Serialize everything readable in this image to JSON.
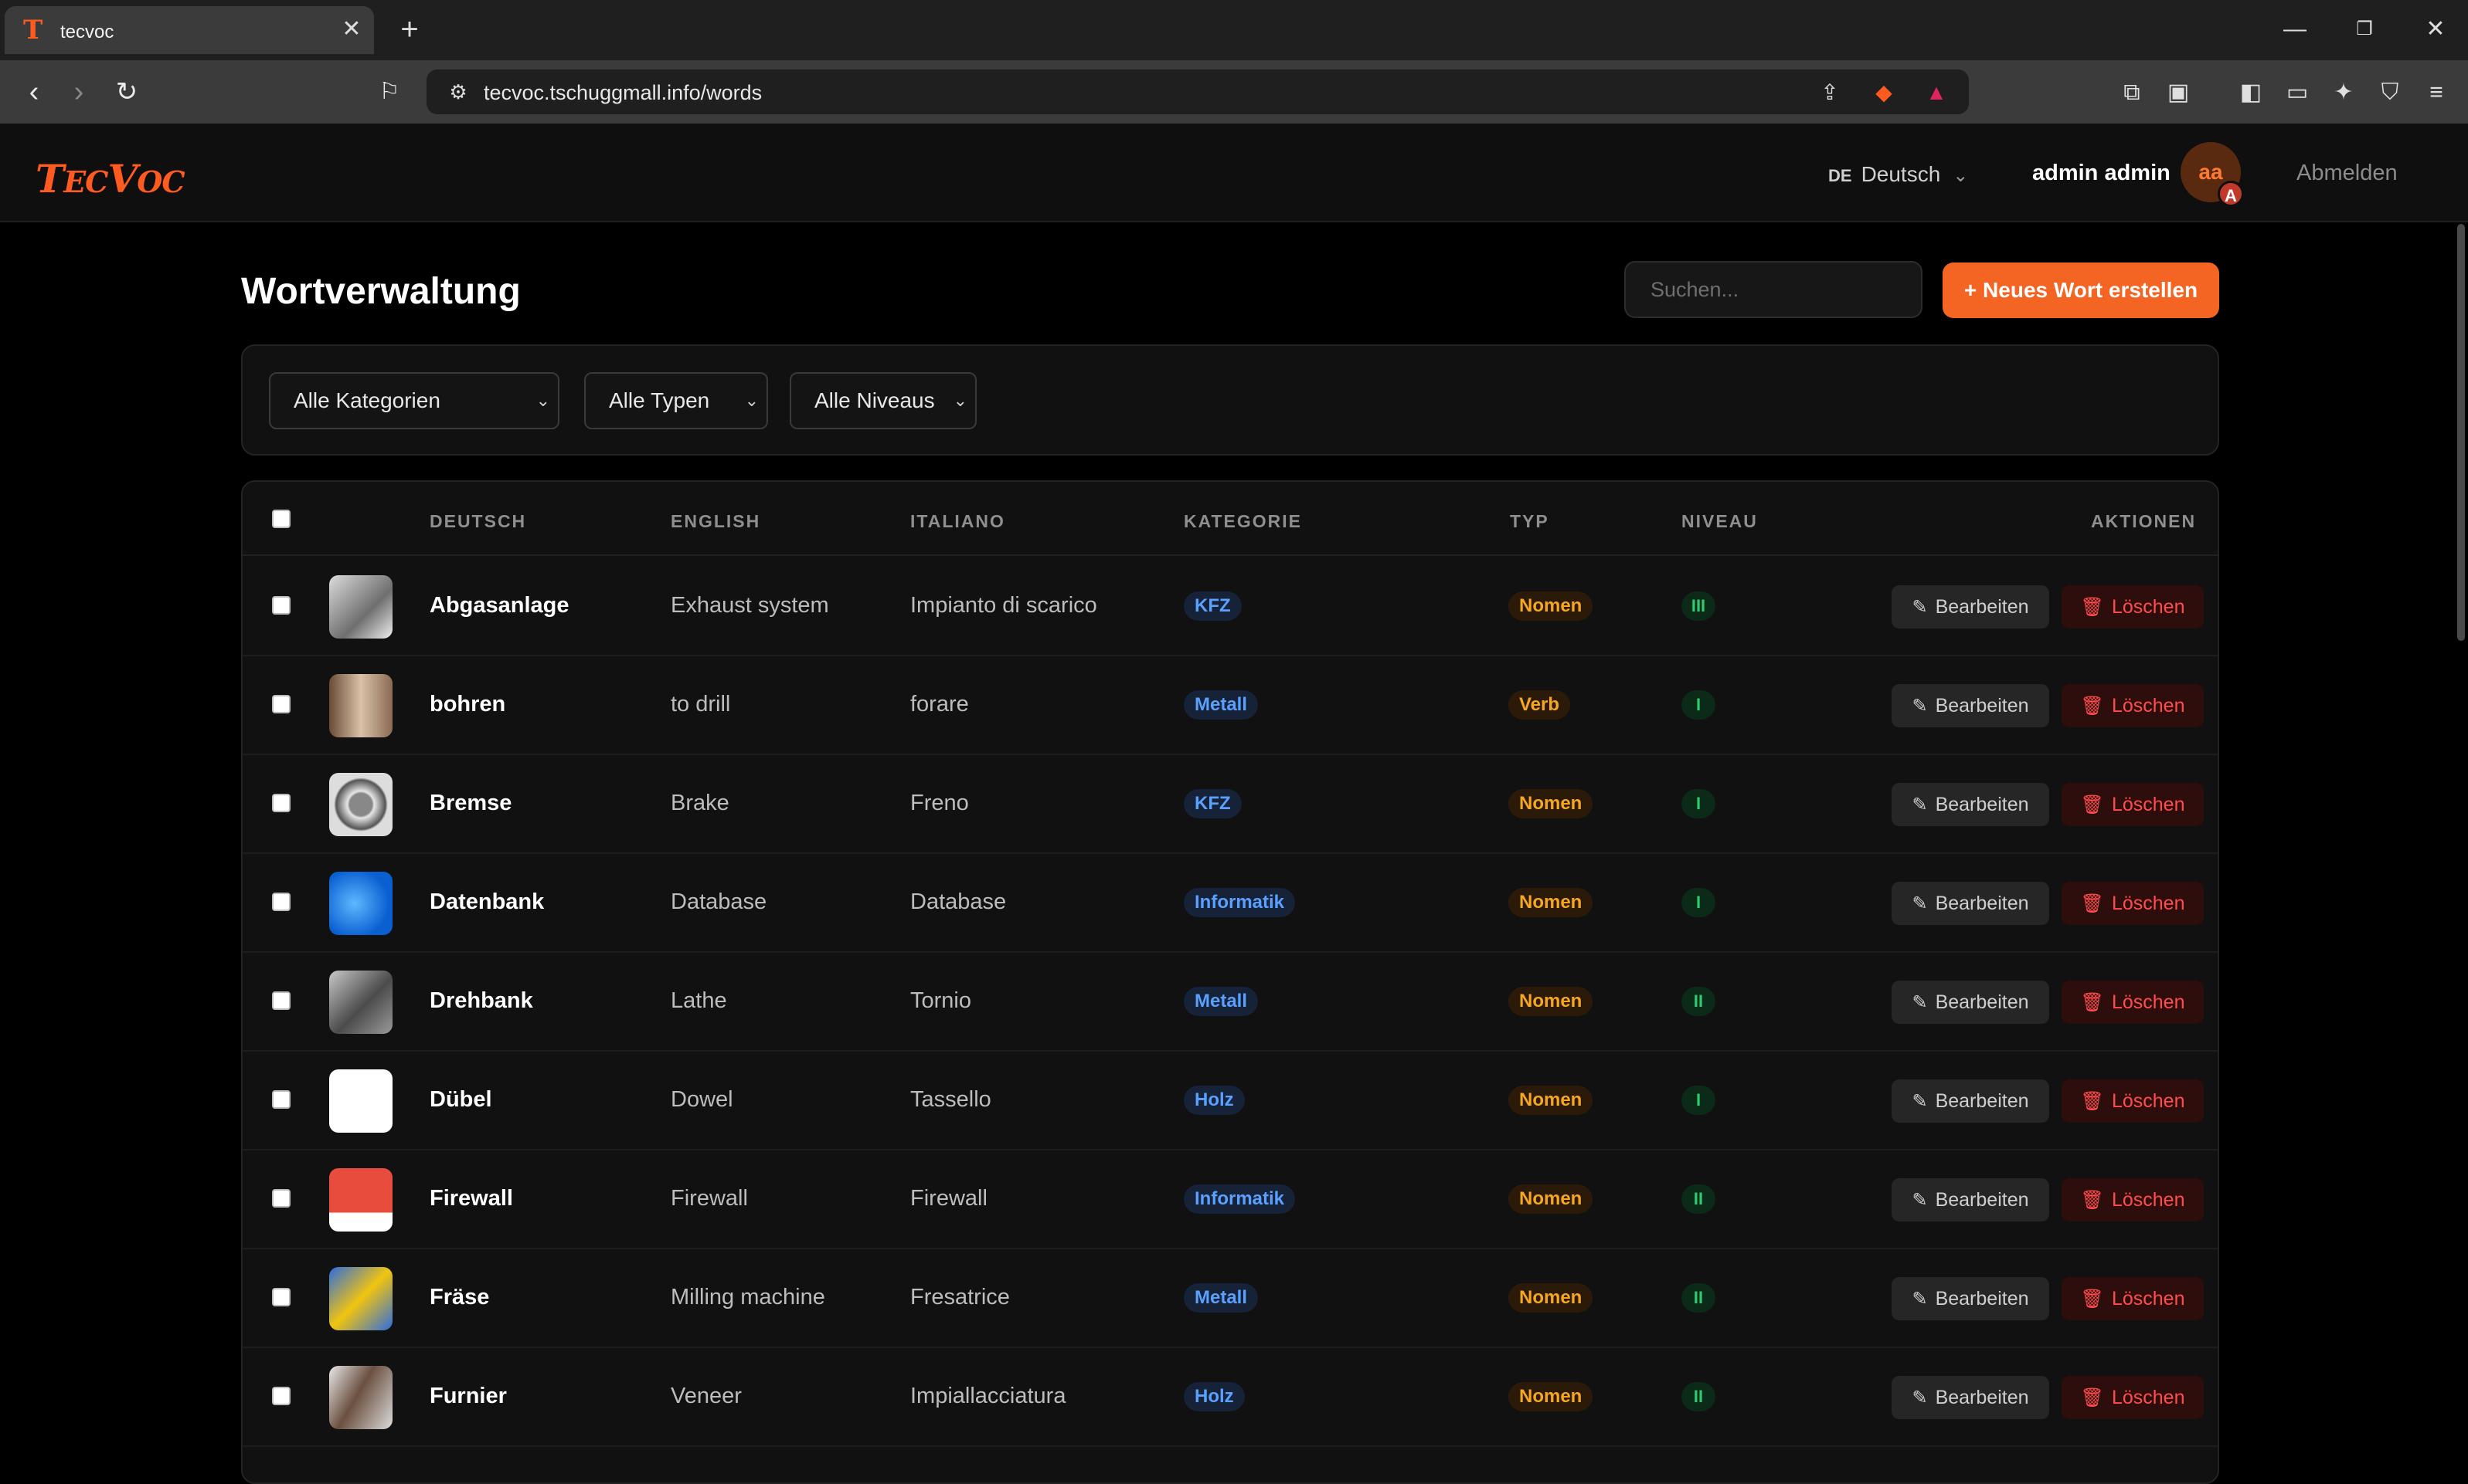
{
  "browser": {
    "tab_title": "tecvoc",
    "favicon_letter": "T",
    "url": "tecvoc.tschuggmall.info/words"
  },
  "header": {
    "logo_big": "T",
    "logo_rest": "EC",
    "logo_big2": "V",
    "logo_rest2": "OC",
    "lang_code": "DE",
    "lang_label": "Deutsch",
    "user_name": "admin admin",
    "avatar_initials": "aa",
    "avatar_badge": "A",
    "logout_label": "Abmelden"
  },
  "main": {
    "title": "Wortverwaltung",
    "search_placeholder": "Suchen...",
    "new_button": "+ Neues Wort erstellen",
    "filters": {
      "category": "Alle Kategorien",
      "type": "Alle Typen",
      "level": "Alle Niveaus"
    },
    "columns": [
      "DEUTSCH",
      "ENGLISH",
      "ITALIANO",
      "KATEGORIE",
      "TYP",
      "NIVEAU",
      "AKTIONEN"
    ],
    "edit_label": "Bearbeiten",
    "delete_label": "Löschen",
    "rows": [
      {
        "de": "Abgasanlage",
        "en": "Exhaust system",
        "it": "Impianto di scarico",
        "category": "KFZ",
        "type": "Nomen",
        "level": "III"
      },
      {
        "de": "bohren",
        "en": "to drill",
        "it": "forare",
        "category": "Metall",
        "type": "Verb",
        "level": "I"
      },
      {
        "de": "Bremse",
        "en": "Brake",
        "it": "Freno",
        "category": "KFZ",
        "type": "Nomen",
        "level": "I"
      },
      {
        "de": "Datenbank",
        "en": "Database",
        "it": "Database",
        "category": "Informatik",
        "type": "Nomen",
        "level": "I"
      },
      {
        "de": "Drehbank",
        "en": "Lathe",
        "it": "Tornio",
        "category": "Metall",
        "type": "Nomen",
        "level": "II"
      },
      {
        "de": "Dübel",
        "en": "Dowel",
        "it": "Tassello",
        "category": "Holz",
        "type": "Nomen",
        "level": "I"
      },
      {
        "de": "Firewall",
        "en": "Firewall",
        "it": "Firewall",
        "category": "Informatik",
        "type": "Nomen",
        "level": "II"
      },
      {
        "de": "Fräse",
        "en": "Milling machine",
        "it": "Fresatrice",
        "category": "Metall",
        "type": "Nomen",
        "level": "II"
      },
      {
        "de": "Furnier",
        "en": "Veneer",
        "it": "Impiallacciatura",
        "category": "Holz",
        "type": "Nomen",
        "level": "II"
      }
    ]
  },
  "colors": {
    "accent": "#f46524",
    "category_text": "#5aa0ff",
    "type_text": "#f5a623",
    "level_text": "#2ecc71",
    "delete_text": "#ff4d4d"
  }
}
